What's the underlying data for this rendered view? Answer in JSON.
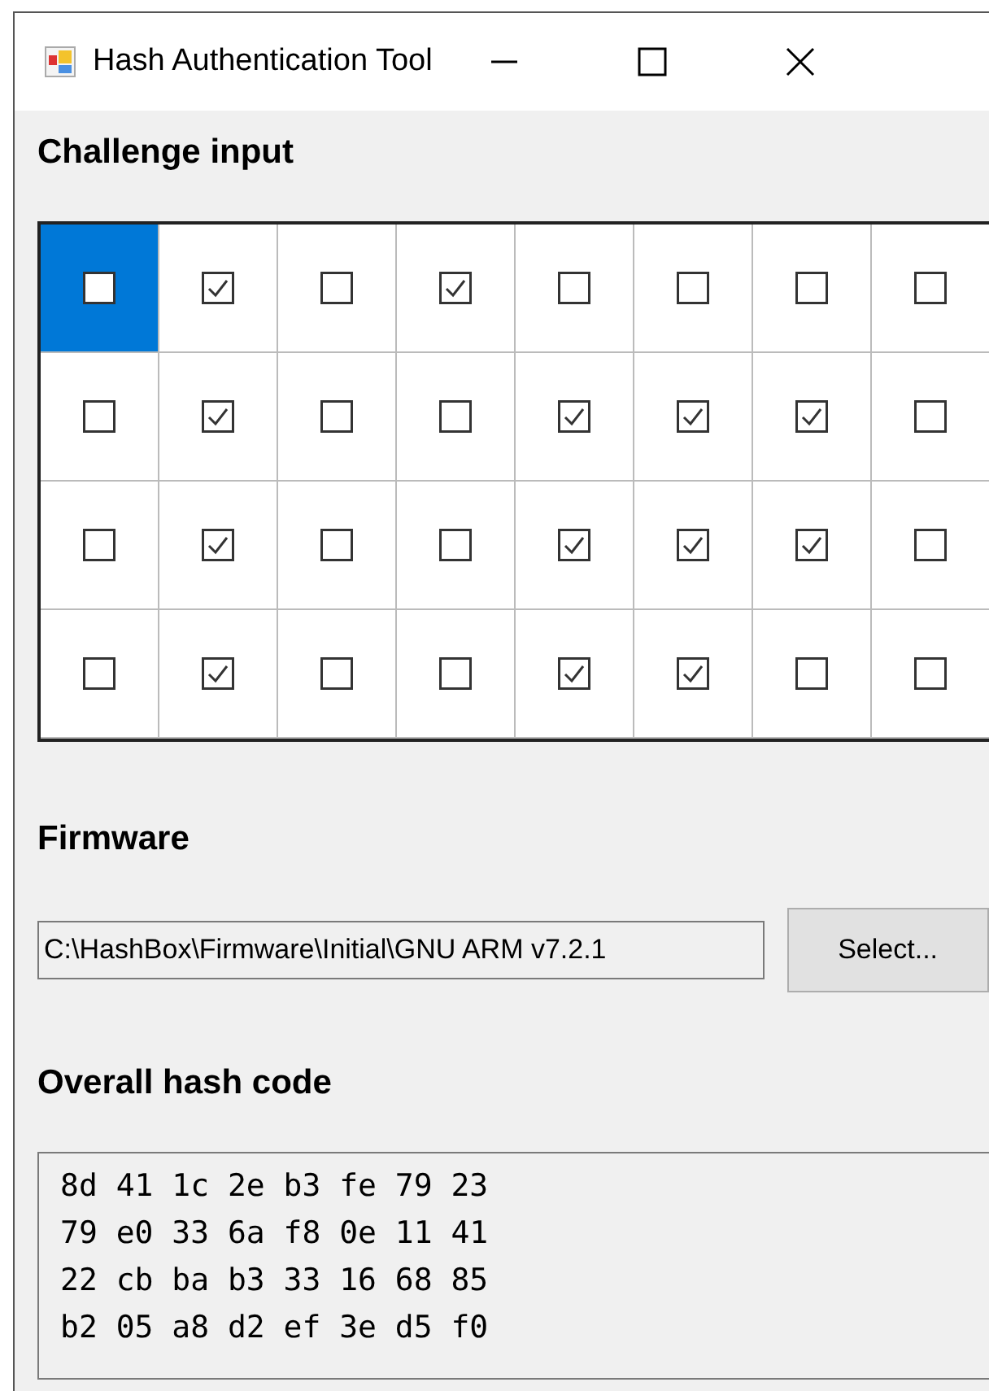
{
  "window": {
    "title": "Hash Authentication Tool"
  },
  "challenge": {
    "label": "Challenge input",
    "rows": [
      [
        {
          "checked": false,
          "selected": true
        },
        {
          "checked": true,
          "selected": false
        },
        {
          "checked": false,
          "selected": false
        },
        {
          "checked": true,
          "selected": false
        },
        {
          "checked": false,
          "selected": false
        },
        {
          "checked": false,
          "selected": false
        },
        {
          "checked": false,
          "selected": false
        },
        {
          "checked": false,
          "selected": false
        }
      ],
      [
        {
          "checked": false,
          "selected": false
        },
        {
          "checked": true,
          "selected": false
        },
        {
          "checked": false,
          "selected": false
        },
        {
          "checked": false,
          "selected": false
        },
        {
          "checked": true,
          "selected": false
        },
        {
          "checked": true,
          "selected": false
        },
        {
          "checked": true,
          "selected": false
        },
        {
          "checked": false,
          "selected": false
        }
      ],
      [
        {
          "checked": false,
          "selected": false
        },
        {
          "checked": true,
          "selected": false
        },
        {
          "checked": false,
          "selected": false
        },
        {
          "checked": false,
          "selected": false
        },
        {
          "checked": true,
          "selected": false
        },
        {
          "checked": true,
          "selected": false
        },
        {
          "checked": true,
          "selected": false
        },
        {
          "checked": false,
          "selected": false
        }
      ],
      [
        {
          "checked": false,
          "selected": false
        },
        {
          "checked": true,
          "selected": false
        },
        {
          "checked": false,
          "selected": false
        },
        {
          "checked": false,
          "selected": false
        },
        {
          "checked": true,
          "selected": false
        },
        {
          "checked": true,
          "selected": false
        },
        {
          "checked": false,
          "selected": false
        },
        {
          "checked": false,
          "selected": false
        }
      ]
    ]
  },
  "firmware": {
    "label": "Firmware",
    "path": "C:\\HashBox\\Firmware\\Initial\\GNU ARM v7.2.1",
    "button": "Select..."
  },
  "hash": {
    "label": "Overall hash code",
    "lines": [
      "8d 41 1c 2e b3 fe 79 23",
      "79 e0 33 6a f8 0e 11 41",
      "22 cb ba b3 33 16 68 85",
      "b2 05 a8 d2 ef 3e d5 f0"
    ]
  }
}
